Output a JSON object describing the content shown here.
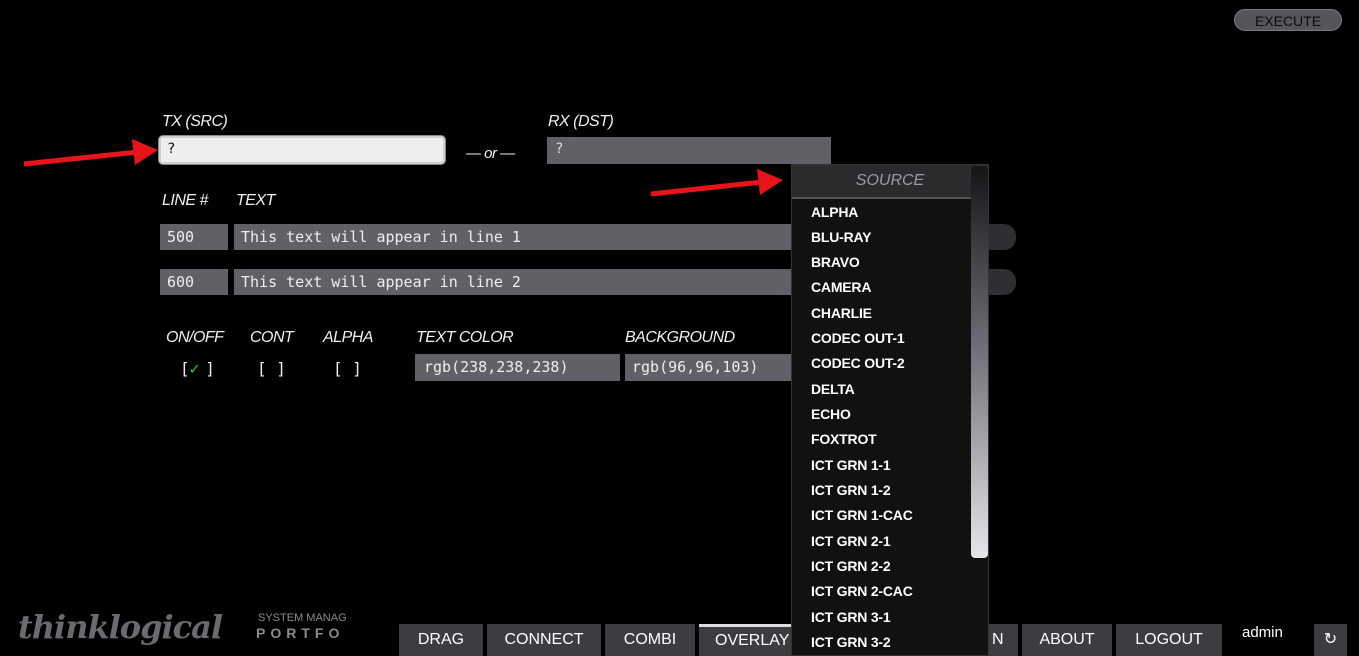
{
  "header": {
    "execute_label": "EXECUTE"
  },
  "tx": {
    "label": "TX (SRC)",
    "value": "?"
  },
  "or_label": "— or —",
  "rx": {
    "label": "RX (DST)",
    "value": "?"
  },
  "lines": {
    "line_label": "LINE #",
    "text_label": "TEXT",
    "rows": [
      {
        "number": "500",
        "text": "This text will appear in line 1"
      },
      {
        "number": "600",
        "text": "This text will appear in line 2"
      }
    ]
  },
  "options": {
    "onoff_label": "ON/OFF",
    "cont_label": "CONT",
    "alpha_label": "ALPHA",
    "text_color_label": "TEXT COLOR",
    "background_label": "BACKGROUND",
    "onoff_open": "[",
    "onoff_mark": "✓",
    "onoff_close": "]",
    "cont_value": "[ ]",
    "alpha_value": "[ ]",
    "text_color_value": "rgb(238,238,238)",
    "background_value": "rgb(96,96,103)"
  },
  "dropdown": {
    "header": "SOURCE",
    "items": [
      "ALPHA",
      "BLU-RAY",
      "BRAVO",
      "CAMERA",
      "CHARLIE",
      "CODEC OUT-1",
      "CODEC OUT-2",
      "DELTA",
      "ECHO",
      "FOXTROT",
      "ICT GRN 1-1",
      "ICT GRN 1-2",
      "ICT GRN 1-CAC",
      "ICT GRN 2-1",
      "ICT GRN 2-2",
      "ICT GRN 2-CAC",
      "ICT GRN 3-1",
      "ICT GRN 3-2"
    ]
  },
  "brand": {
    "logo": "thinklogical",
    "sub1": "SYSTEM MANAG",
    "sub2": "PORTFO"
  },
  "nav": {
    "drag": "DRAG",
    "connect": "CONNECT",
    "combi": "COMBI",
    "overlay": "OVERLAY",
    "hidden_partial": "N",
    "about": "ABOUT",
    "logout": "LOGOUT"
  },
  "user": "admin",
  "refresh_icon": "↻",
  "colors": {
    "field_bg": "#606067",
    "check_green": "#22dd22",
    "arrow_red": "#e8141a"
  }
}
